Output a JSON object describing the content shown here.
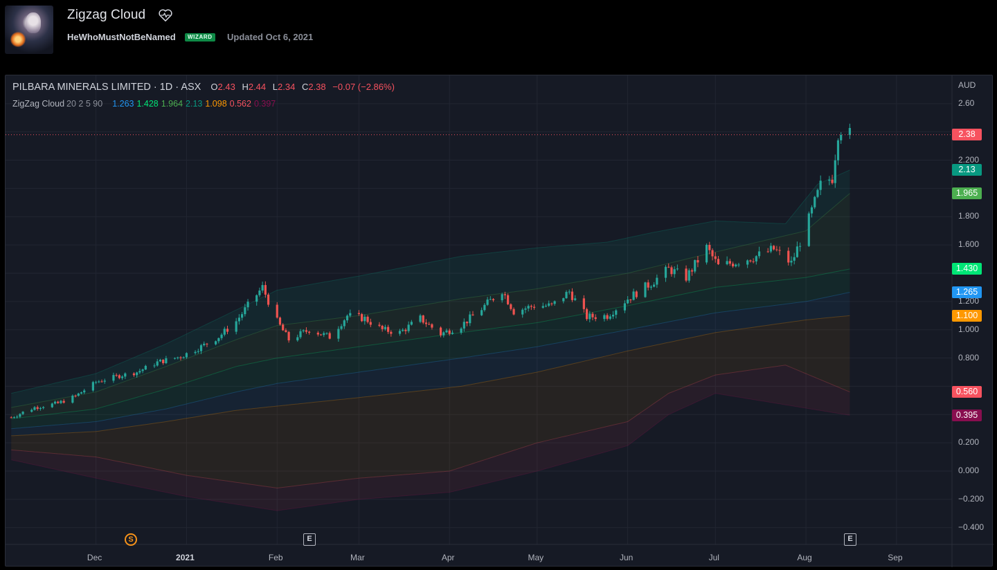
{
  "header": {
    "title": "Zigzag Cloud",
    "author": "HeWhoMustNotBeNamed",
    "badge": "WIZARD",
    "updated": "Updated Oct 6, 2021"
  },
  "legend": {
    "symbol": "PILBARA MINERALS LIMITED · 1D · ASX",
    "ohlc": {
      "o_label": "O",
      "o": "2.43",
      "h_label": "H",
      "h": "2.44",
      "l_label": "L",
      "l": "2.34",
      "c_label": "C",
      "c": "2.38",
      "change": "−0.07 (−2.86%)"
    },
    "indicator_name": "ZigZag Cloud",
    "indicator_params": "20 2 5 90",
    "indicator_values": [
      {
        "value": "1.263",
        "color": "#2196f3"
      },
      {
        "value": "1.428",
        "color": "#00e676"
      },
      {
        "value": "1.964",
        "color": "#4caf50"
      },
      {
        "value": "2.13",
        "color": "#089981"
      },
      {
        "value": "1.098",
        "color": "#ff9800"
      },
      {
        "value": "0.562",
        "color": "#f7525f"
      },
      {
        "value": "0.397",
        "color": "#880e4f"
      }
    ]
  },
  "price_axis": {
    "currency": "AUD",
    "ticks": [
      "2.60",
      "2.200",
      "1.800",
      "1.600",
      "1.200",
      "1.000",
      "0.800",
      "0.200",
      "0.000",
      "−0.200",
      "−0.400"
    ],
    "tick_values": [
      2.6,
      2.2,
      1.8,
      1.6,
      1.2,
      1.0,
      0.8,
      0.2,
      0.0,
      -0.2,
      -0.4
    ],
    "price_tags": [
      {
        "label": "2.38",
        "value": 2.38,
        "color": "#f7525f"
      },
      {
        "label": "2.13",
        "value": 2.13,
        "color": "#089981"
      },
      {
        "label": "1.965",
        "value": 1.965,
        "color": "#4caf50"
      },
      {
        "label": "1.430",
        "value": 1.43,
        "color": "#00e676"
      },
      {
        "label": "1.265",
        "value": 1.265,
        "color": "#2196f3"
      },
      {
        "label": "1.100",
        "value": 1.1,
        "color": "#ff9800"
      },
      {
        "label": "0.560",
        "value": 0.56,
        "color": "#f7525f"
      },
      {
        "label": "0.395",
        "value": 0.395,
        "color": "#880e4f"
      }
    ]
  },
  "time_axis": {
    "labels": [
      "Dec",
      "2021",
      "Feb",
      "Mar",
      "Apr",
      "May",
      "Jun",
      "Jul",
      "Aug",
      "Sep"
    ],
    "bold": [
      "2021"
    ],
    "events": [
      {
        "label": "S",
        "kind": "split",
        "month": "Dec"
      },
      {
        "label": "E",
        "kind": "earnings",
        "month": "Feb"
      },
      {
        "label": "E",
        "kind": "earnings",
        "month": "Aug"
      }
    ]
  },
  "chart_data": {
    "type": "candlestick",
    "title": "PILBARA MINERALS LIMITED · 1D · ASX",
    "currency": "AUD",
    "last_close": 2.38,
    "colors": {
      "up": "#26a69a",
      "down": "#ef5350"
    },
    "ylim": [
      -0.45,
      2.72
    ],
    "close_path": [
      [
        "2020-11-02",
        0.38
      ],
      [
        "2020-11-10",
        0.45
      ],
      [
        "2020-11-18",
        0.48
      ],
      [
        "2020-11-24",
        0.53
      ],
      [
        "2020-12-01",
        0.63
      ],
      [
        "2020-12-08",
        0.67
      ],
      [
        "2020-12-15",
        0.7
      ],
      [
        "2020-12-22",
        0.77
      ],
      [
        "2020-12-30",
        0.81
      ],
      [
        "2021-01-06",
        0.88
      ],
      [
        "2021-01-12",
        0.95
      ],
      [
        "2021-01-18",
        1.06
      ],
      [
        "2021-01-22",
        1.17
      ],
      [
        "2021-01-27",
        1.3
      ],
      [
        "2021-02-01",
        1.06
      ],
      [
        "2021-02-05",
        0.93
      ],
      [
        "2021-02-12",
        1.0
      ],
      [
        "2021-02-19",
        0.95
      ],
      [
        "2021-02-25",
        1.1
      ],
      [
        "2021-03-03",
        1.08
      ],
      [
        "2021-03-09",
        1.0
      ],
      [
        "2021-03-15",
        0.98
      ],
      [
        "2021-03-22",
        1.08
      ],
      [
        "2021-03-29",
        0.97
      ],
      [
        "2021-04-05",
        1.03
      ],
      [
        "2021-04-12",
        1.15
      ],
      [
        "2021-04-19",
        1.28
      ],
      [
        "2021-04-23",
        1.13
      ],
      [
        "2021-04-30",
        1.17
      ],
      [
        "2021-05-06",
        1.17
      ],
      [
        "2021-05-12",
        1.27
      ],
      [
        "2021-05-18",
        1.09
      ],
      [
        "2021-05-25",
        1.1
      ],
      [
        "2021-06-01",
        1.22
      ],
      [
        "2021-06-09",
        1.33
      ],
      [
        "2021-06-15",
        1.43
      ],
      [
        "2021-06-21",
        1.37
      ],
      [
        "2021-06-28",
        1.58
      ],
      [
        "2021-07-02",
        1.45
      ],
      [
        "2021-07-08",
        1.48
      ],
      [
        "2021-07-15",
        1.52
      ],
      [
        "2021-07-21",
        1.57
      ],
      [
        "2021-07-27",
        1.47
      ],
      [
        "2021-08-02",
        1.78
      ],
      [
        "2021-08-06",
        2.02
      ],
      [
        "2021-08-10",
        2.08
      ],
      [
        "2021-08-12",
        2.4
      ],
      [
        "2021-08-14",
        2.45
      ],
      [
        "2021-08-16",
        2.38
      ]
    ],
    "bands": [
      {
        "name": "upper",
        "color": "#089981",
        "values": [
          [
            "2020-11-02",
            0.55
          ],
          [
            "2020-12-01",
            0.69
          ],
          [
            "2020-12-25",
            0.9
          ],
          [
            "2021-01-18",
            1.14
          ],
          [
            "2021-02-01",
            1.28
          ],
          [
            "2021-03-01",
            1.38
          ],
          [
            "2021-04-05",
            1.52
          ],
          [
            "2021-05-01",
            1.58
          ],
          [
            "2021-05-25",
            1.62
          ],
          [
            "2021-06-10",
            1.69
          ],
          [
            "2021-07-01",
            1.77
          ],
          [
            "2021-07-25",
            1.75
          ],
          [
            "2021-08-05",
            2.03
          ],
          [
            "2021-08-16",
            2.13
          ]
        ]
      },
      {
        "name": "mid-upper",
        "color": "#4caf50",
        "values": [
          [
            "2020-11-02",
            0.45
          ],
          [
            "2020-12-01",
            0.56
          ],
          [
            "2020-12-25",
            0.74
          ],
          [
            "2021-01-18",
            0.93
          ],
          [
            "2021-02-01",
            1.03
          ],
          [
            "2021-03-01",
            1.1
          ],
          [
            "2021-04-05",
            1.22
          ],
          [
            "2021-05-01",
            1.29
          ],
          [
            "2021-06-01",
            1.4
          ],
          [
            "2021-07-01",
            1.55
          ],
          [
            "2021-08-01",
            1.7
          ],
          [
            "2021-08-16",
            1.965
          ]
        ]
      },
      {
        "name": "mid",
        "color": "#00e676",
        "values": [
          [
            "2020-11-02",
            0.37
          ],
          [
            "2020-12-01",
            0.44
          ],
          [
            "2020-12-25",
            0.58
          ],
          [
            "2021-01-18",
            0.74
          ],
          [
            "2021-02-01",
            0.8
          ],
          [
            "2021-03-01",
            0.88
          ],
          [
            "2021-04-05",
            0.98
          ],
          [
            "2021-05-01",
            1.05
          ],
          [
            "2021-06-01",
            1.17
          ],
          [
            "2021-07-01",
            1.3
          ],
          [
            "2021-08-01",
            1.37
          ],
          [
            "2021-08-16",
            1.43
          ]
        ]
      },
      {
        "name": "mid-lower",
        "color": "#2196f3",
        "values": [
          [
            "2020-11-02",
            0.3
          ],
          [
            "2020-12-01",
            0.35
          ],
          [
            "2020-12-25",
            0.44
          ],
          [
            "2021-01-18",
            0.56
          ],
          [
            "2021-02-01",
            0.62
          ],
          [
            "2021-03-01",
            0.7
          ],
          [
            "2021-04-05",
            0.8
          ],
          [
            "2021-05-01",
            0.88
          ],
          [
            "2021-06-01",
            1.0
          ],
          [
            "2021-07-01",
            1.12
          ],
          [
            "2021-08-01",
            1.2
          ],
          [
            "2021-08-16",
            1.265
          ]
        ]
      },
      {
        "name": "lower",
        "color": "#ff9800",
        "values": [
          [
            "2020-11-02",
            0.25
          ],
          [
            "2020-12-01",
            0.28
          ],
          [
            "2020-12-25",
            0.35
          ],
          [
            "2021-01-18",
            0.43
          ],
          [
            "2021-02-01",
            0.46
          ],
          [
            "2021-03-01",
            0.52
          ],
          [
            "2021-04-05",
            0.6
          ],
          [
            "2021-05-01",
            0.7
          ],
          [
            "2021-06-01",
            0.85
          ],
          [
            "2021-07-01",
            0.98
          ],
          [
            "2021-08-01",
            1.07
          ],
          [
            "2021-08-16",
            1.1
          ]
        ]
      },
      {
        "name": "deep-lower",
        "color": "#f7525f",
        "values": [
          [
            "2020-11-02",
            0.15
          ],
          [
            "2020-12-01",
            0.1
          ],
          [
            "2021-01-01",
            -0.03
          ],
          [
            "2021-02-01",
            -0.12
          ],
          [
            "2021-03-01",
            -0.05
          ],
          [
            "2021-04-01",
            0.0
          ],
          [
            "2021-05-01",
            0.2
          ],
          [
            "2021-06-01",
            0.35
          ],
          [
            "2021-06-15",
            0.55
          ],
          [
            "2021-07-01",
            0.68
          ],
          [
            "2021-07-25",
            0.75
          ],
          [
            "2021-08-16",
            0.56
          ]
        ]
      },
      {
        "name": "bottom",
        "color": "#880e4f",
        "values": [
          [
            "2020-11-02",
            0.08
          ],
          [
            "2020-12-01",
            -0.05
          ],
          [
            "2021-01-01",
            -0.18
          ],
          [
            "2021-02-01",
            -0.28
          ],
          [
            "2021-03-01",
            -0.2
          ],
          [
            "2021-04-01",
            -0.15
          ],
          [
            "2021-05-01",
            0.0
          ],
          [
            "2021-06-01",
            0.18
          ],
          [
            "2021-06-15",
            0.4
          ],
          [
            "2021-07-01",
            0.55
          ],
          [
            "2021-08-16",
            0.395
          ]
        ]
      }
    ],
    "grid": true
  }
}
